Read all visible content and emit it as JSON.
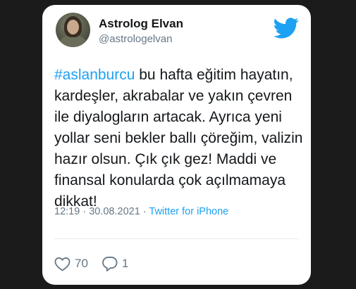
{
  "user": {
    "name": "Astrolog Elvan",
    "handle": "@astrologelvan"
  },
  "tweet": {
    "hashtag": "#aslanburcu",
    "text": " bu hafta eğitim hayatın, kardeşler, akrabalar ve yakın çevren ile diyalogların artacak. Ayrıca yeni yollar seni bekler ballı çöreğim, valizin hazır olsun. Çık çık gez! Maddi ve finansal konularda çok açılmamaya dikkat!",
    "time": "12:19",
    "separator1": " · ",
    "date": "30.08.2021",
    "separator2": " · ",
    "source": "Twitter for iPhone"
  },
  "stats": {
    "likes": "70",
    "replies": "1"
  },
  "icons": {
    "brand": "twitter-bird-icon",
    "like": "heart-icon",
    "reply": "speech-bubble-icon"
  },
  "colors": {
    "background": "#1b1b1b",
    "card": "#ffffff",
    "accent": "#1da1f2",
    "text": "#14171a",
    "muted": "#657786"
  }
}
